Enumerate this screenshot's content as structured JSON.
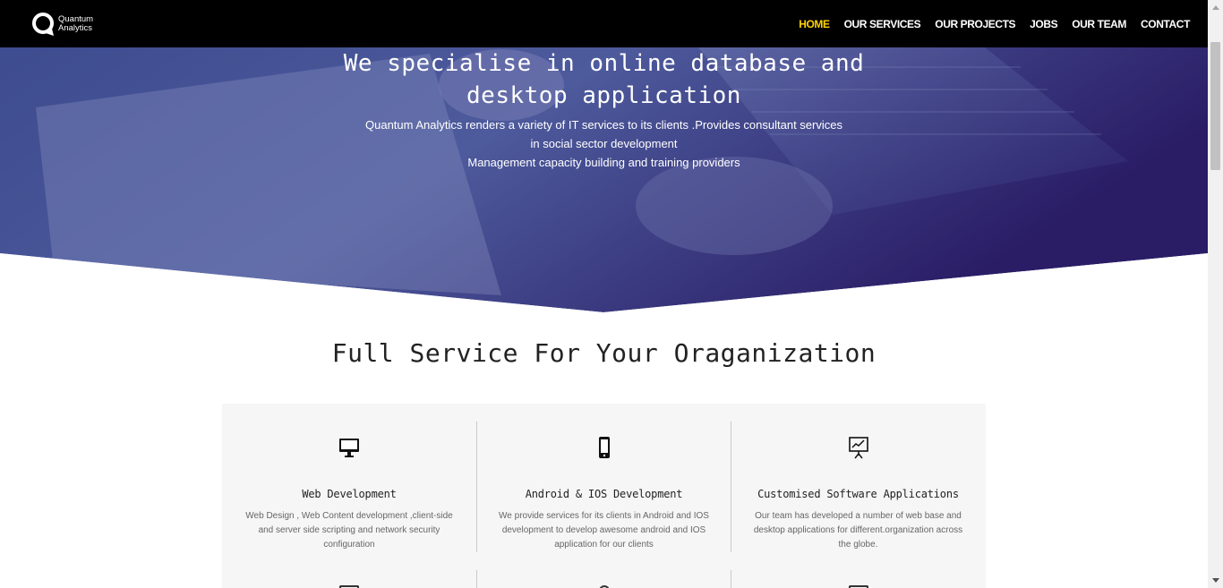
{
  "nav": {
    "logo_line1": "Quantum",
    "logo_line2": "Analytics",
    "links": [
      "HOME",
      "OUR SERVICES",
      "OUR PROJECTS",
      "JOBS",
      "OUR TEAM",
      "CONTACT"
    ],
    "active": "HOME",
    "active_color": "#ffd200"
  },
  "hero": {
    "title_line1": "We specialise in online database and",
    "title_line2": "desktop application",
    "sub_line1": "Quantum Analytics renders a variety of IT services to its clients .Provides consultant services",
    "sub_line2": "in social sector development",
    "sub_line3": "Management capacity building and training providers",
    "overlay_color": "#2a2f7a"
  },
  "section": {
    "title": "Full Service For Your Oraganization"
  },
  "services": [
    {
      "icon": "monitor-icon",
      "title": "Web Development",
      "desc": "Web Design , Web Content development ,client-side and server side scripting and network security configuration"
    },
    {
      "icon": "mobile-phone-icon",
      "title": "Android & IOS Development",
      "desc": "We provide services for its clients in Android  and IOS development  to develop awesome android and IOS application for our  clients"
    },
    {
      "icon": "presentation-chart-icon",
      "title": "Customised Software Applications",
      "desc": "Our team has developed a number of web base and desktop applications for different.organization across the globe."
    }
  ]
}
